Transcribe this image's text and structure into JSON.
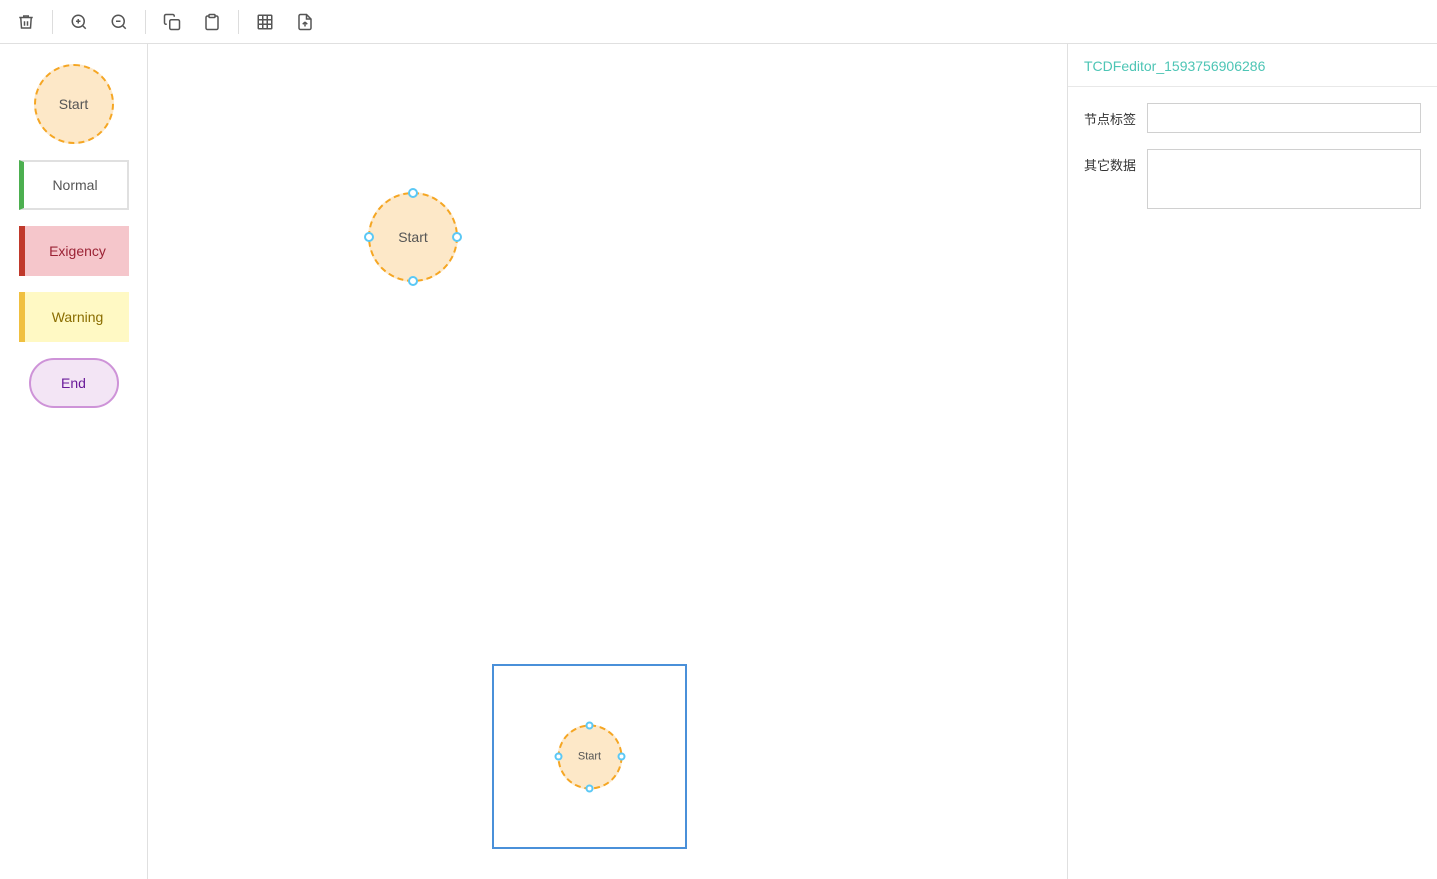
{
  "toolbar": {
    "buttons": [
      {
        "name": "delete-button",
        "icon": "🗑",
        "label": "Delete"
      },
      {
        "name": "zoom-in-button",
        "icon": "🔍+",
        "label": "Zoom In"
      },
      {
        "name": "zoom-out-button",
        "icon": "🔍-",
        "label": "Zoom Out"
      },
      {
        "name": "copy-button",
        "icon": "📋",
        "label": "Copy"
      },
      {
        "name": "paste-button",
        "icon": "📄",
        "label": "Paste"
      },
      {
        "name": "fit-button",
        "icon": "⊡",
        "label": "Fit"
      },
      {
        "name": "export-button",
        "icon": "💾",
        "label": "Export"
      }
    ]
  },
  "sidebar": {
    "nodes": [
      {
        "name": "start-node-item",
        "label": "Start",
        "type": "start"
      },
      {
        "name": "normal-node-item",
        "label": "Normal",
        "type": "normal"
      },
      {
        "name": "exigency-node-item",
        "label": "Exigency",
        "type": "exigency"
      },
      {
        "name": "warning-node-item",
        "label": "Warning",
        "type": "warning"
      },
      {
        "name": "end-node-item",
        "label": "End",
        "type": "end"
      }
    ]
  },
  "canvas": {
    "node": {
      "label": "Start"
    },
    "minimap": {
      "node_label": "Start"
    }
  },
  "right_panel": {
    "title": "TCDFeditor_1593756906286",
    "label_field": "节点标签",
    "data_field": "其它数据",
    "label_placeholder": "",
    "data_placeholder": ""
  }
}
